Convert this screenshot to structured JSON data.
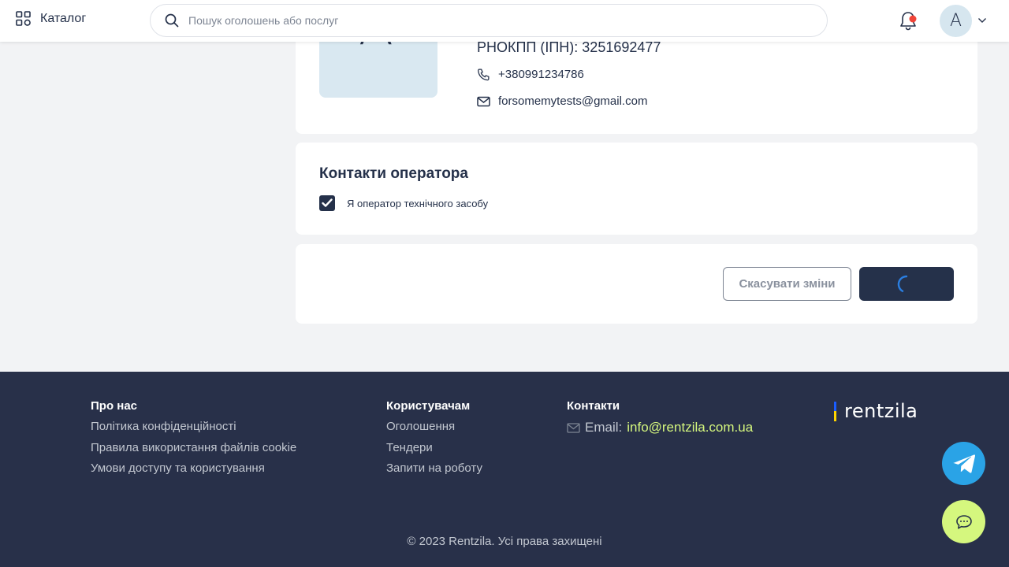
{
  "header": {
    "catalog_label": "Каталог",
    "search_placeholder": "Пошук оголошень або послуг",
    "avatar_letter": "А"
  },
  "profile": {
    "avatar_letter": "А",
    "rnokpp": "РНОКПП (ІПН): 3251692477",
    "phone": "+380991234786",
    "email": "forsomemytests@gmail.com"
  },
  "operator": {
    "title": "Контакти оператора",
    "checkbox_label": "Я оператор технічного засобу",
    "checked": true
  },
  "actions": {
    "cancel_label": "Скасувати зміни",
    "save_state": "loading"
  },
  "footer": {
    "about": {
      "heading": "Про нас",
      "links": [
        "Політика конфіденційності",
        "Правила використання файлів cookie",
        "Умови доступу та користування"
      ]
    },
    "users": {
      "heading": "Користувачам",
      "links": [
        "Оголошення",
        "Тендери",
        "Запити на роботу"
      ]
    },
    "contacts": {
      "heading": "Контакти",
      "email_prefix": "Email:",
      "email": "info@rentzila.com.ua"
    },
    "logo_text": "rentzila",
    "copyright": "© 2023 Rentzila. Усі права захищені"
  },
  "colors": {
    "primary": "#25314a",
    "accent": "#d5f77e",
    "telegram": "#2aa3e6",
    "notification_dot": "#f04438"
  },
  "icons": [
    "grid-icon",
    "search-icon",
    "bell-icon",
    "chevron-down-icon",
    "phone-icon",
    "mail-icon",
    "check-icon",
    "spinner-icon",
    "telegram-icon",
    "chat-icon"
  ]
}
